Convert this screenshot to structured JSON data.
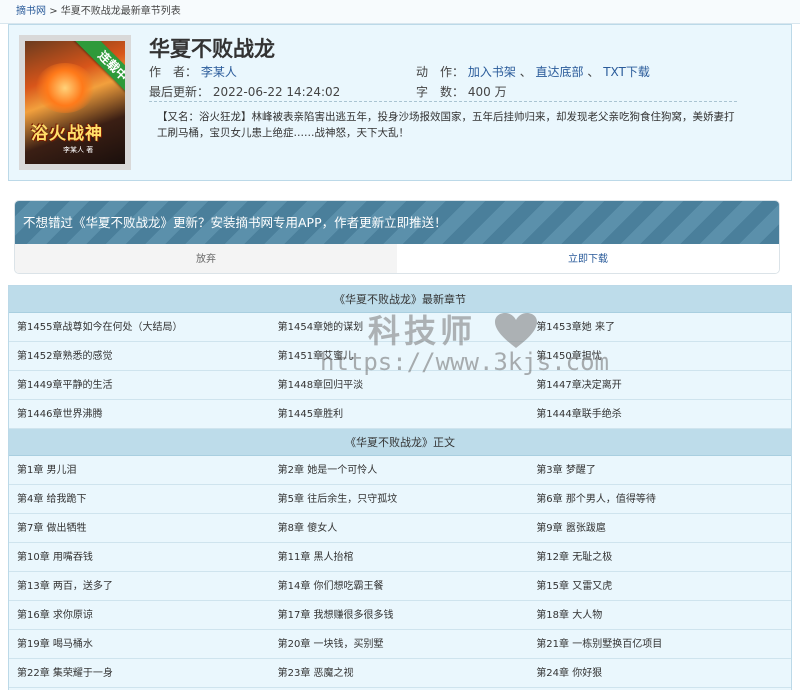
{
  "breadcrumb": {
    "site": "摘书网",
    "separator": ">",
    "current": "华夏不败战龙最新章节列表"
  },
  "book": {
    "title": "华夏不败战龙",
    "author_label": "作　者：",
    "author": "李某人",
    "updated_label": "最后更新：",
    "updated": "2022-06-22 14:24:02",
    "actions_label": "动　作：",
    "action_shelf": "加入书架",
    "action_sep": "、",
    "action_bottom": "直达底部",
    "action_txt": "TXT下载",
    "words_label": "字　数：",
    "words": "400 万",
    "intro": "【又名：浴火狂龙】林峰被表亲陷害出逃五年，投身沙场报效国家，五年后挂帅归来，却发现老父亲吃狗食住狗窝，美娇妻打工刷马桶，宝贝女儿患上绝症……战神怒，天下大乱！",
    "cover": {
      "ribbon": "连载中",
      "title": "浴火战神",
      "author": "李某人 著"
    }
  },
  "promo": {
    "message": "不想错过《华夏不败战龙》更新？安装摘书网专用APP，作者更新立即推送！",
    "giveup_label": "放弃",
    "download_label": "立即下载"
  },
  "latest": {
    "heading": "《华夏不败战龙》最新章节",
    "items": [
      "第1455章战尊如今在何处（大结局）",
      "第1454章她的谋划",
      "第1453章她 来了",
      "第1452章熟悉的感觉",
      "第1451章艾蜜儿",
      "第1450章担忧",
      "第1449章平静的生活",
      "第1448章回归平淡",
      "第1447章决定离开",
      "第1446章世界沸腾",
      "第1445章胜利",
      "第1444章联手绝杀"
    ]
  },
  "main": {
    "heading": "《华夏不败战龙》正文",
    "items": [
      "第1章 男儿泪",
      "第2章 她是一个可怜人",
      "第3章 梦醒了",
      "第4章 给我跪下",
      "第5章 往后余生，只守孤坟",
      "第6章 那个男人，值得等待",
      "第7章 做出牺牲",
      "第8章 傻女人",
      "第9章 嚣张跋扈",
      "第10章 用嘴吞钱",
      "第11章 黑人抬棺",
      "第12章 无耻之极",
      "第13章 两百，送多了",
      "第14章 你们想吃霸王餐",
      "第15章 又雷又虎",
      "第16章 求你原谅",
      "第17章 我想赚很多很多钱",
      "第18章 大人物",
      "第19章 喝马桶水",
      "第20章 一块钱，买别墅",
      "第21章 一栋别墅换百亿项目",
      "第22章 集荣耀于一身",
      "第23章 恶魔之视",
      "第24章 你好狠"
    ]
  },
  "watermark": {
    "text": "科技师",
    "url": "https://www.3kjs.com"
  },
  "colors": {
    "link": "#2a5b9a",
    "panel_bg": "#eaf7fd",
    "header_bg": "#bddcea",
    "ribbon": "#2e9a3a"
  }
}
